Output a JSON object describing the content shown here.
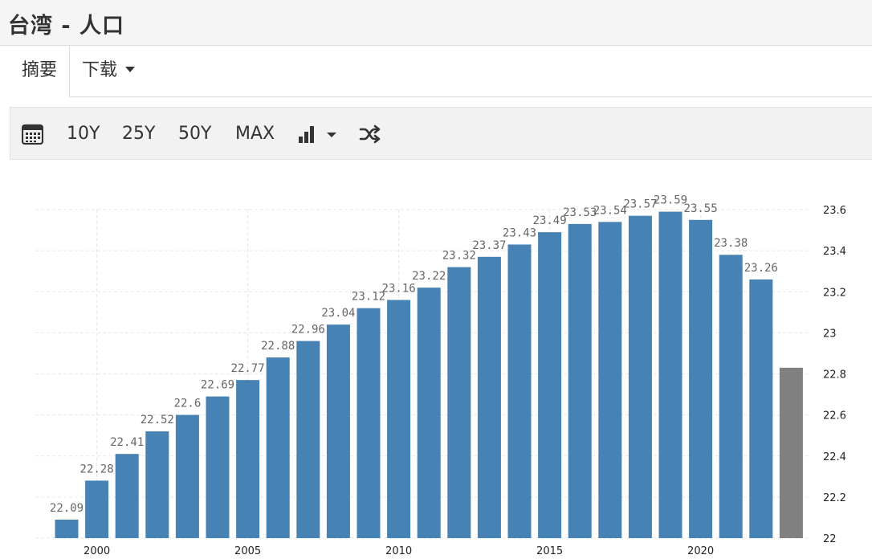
{
  "header": {
    "title": "台湾 - 人口"
  },
  "tabs": [
    {
      "label": "摘要"
    },
    {
      "label": "下载"
    }
  ],
  "toolbar": {
    "calendar_icon": "calendar-icon",
    "ranges": [
      "10Y",
      "25Y",
      "50Y",
      "MAX"
    ],
    "chart_type_icon": "bar-chart-icon",
    "shuffle_icon": "shuffle-icon"
  },
  "chart_data": {
    "type": "bar",
    "title": "",
    "xlabel": "",
    "ylabel": "",
    "x": [
      1999,
      2000,
      2001,
      2002,
      2003,
      2004,
      2005,
      2006,
      2007,
      2008,
      2009,
      2010,
      2011,
      2012,
      2013,
      2014,
      2015,
      2016,
      2017,
      2018,
      2019,
      2020,
      2021,
      2022,
      2023
    ],
    "values": [
      22.09,
      22.28,
      22.41,
      22.52,
      22.6,
      22.69,
      22.77,
      22.88,
      22.96,
      23.04,
      23.12,
      23.16,
      23.22,
      23.32,
      23.37,
      23.43,
      23.49,
      23.53,
      23.54,
      23.57,
      23.59,
      23.55,
      23.38,
      23.26,
      22.83
    ],
    "labels": [
      "22.09",
      "22.28",
      "22.41",
      "22.52",
      "22.6",
      "22.69",
      "22.77",
      "22.88",
      "22.96",
      "23.04",
      "23.12",
      "23.16",
      "23.22",
      "23.32",
      "23.37",
      "23.43",
      "23.49",
      "23.53",
      "23.54",
      "23.57",
      "23.59",
      "23.55",
      "23.38",
      "23.26",
      null
    ],
    "forecast_index": 24,
    "xticks": [
      2000,
      2005,
      2010,
      2015,
      2020
    ],
    "yticks": [
      22,
      22.2,
      22.4,
      22.6,
      22.8,
      23,
      23.2,
      23.4,
      23.6
    ],
    "ylim": [
      22,
      23.6
    ],
    "grid": true,
    "y_axis_position": "right",
    "colors": {
      "bar": "#4682b4",
      "forecast": "#808080",
      "grid": "#e6e6e6"
    }
  }
}
